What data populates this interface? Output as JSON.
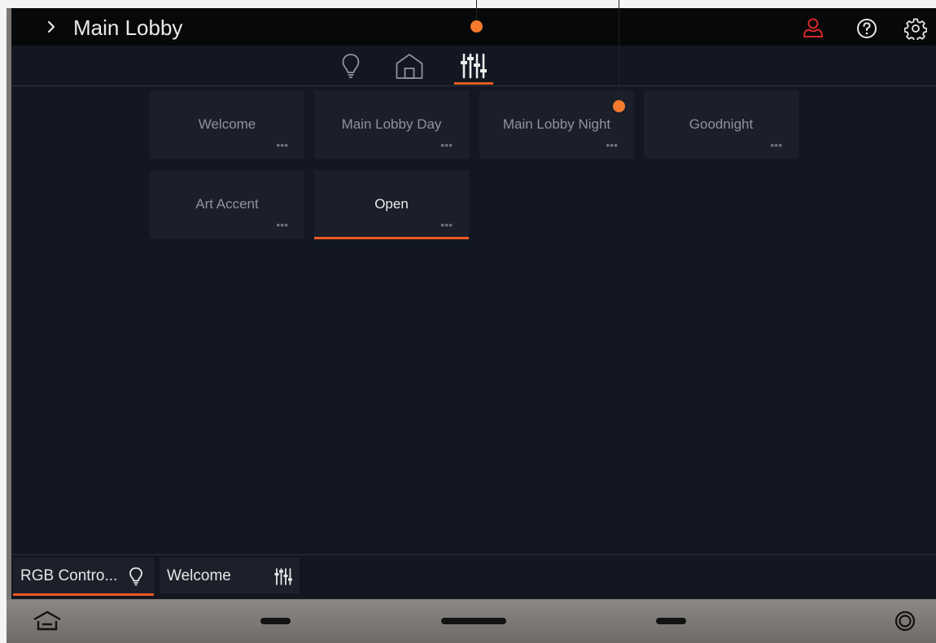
{
  "header": {
    "title": "Main Lobby",
    "chevron_icon": "chevron-right-icon",
    "user_icon": "user-icon",
    "help_icon": "help-circle-icon",
    "settings_icon": "gear-icon",
    "user_icon_color": "#d42a2a"
  },
  "tabs": [
    {
      "name": "lights",
      "icon": "lightbulb-icon",
      "active": false
    },
    {
      "name": "rooms",
      "icon": "house-icon",
      "active": false
    },
    {
      "name": "scenes",
      "icon": "sliders-icon",
      "active": true
    }
  ],
  "scenes": [
    {
      "label": "Welcome",
      "active": false
    },
    {
      "label": "Main Lobby Day",
      "active": false
    },
    {
      "label": "Main Lobby Night",
      "active": false
    },
    {
      "label": "Goodnight",
      "active": false
    },
    {
      "label": "Art Accent",
      "active": false
    },
    {
      "label": "Open",
      "active": true
    }
  ],
  "more_glyph": "•••",
  "bottom_bar": {
    "items": [
      {
        "label": "RGB Contro...",
        "icon": "lightbulb-icon",
        "active": true
      },
      {
        "label": "Welcome",
        "icon": "sliders-icon",
        "active": false
      }
    ]
  },
  "navbar": {
    "home_icon": "home-icon",
    "record_icon": "circle-button-icon"
  },
  "colors": {
    "accent": "#f05a22",
    "marker": "#f47a2e",
    "background": "#121722",
    "tile": "#1a1f2a"
  }
}
